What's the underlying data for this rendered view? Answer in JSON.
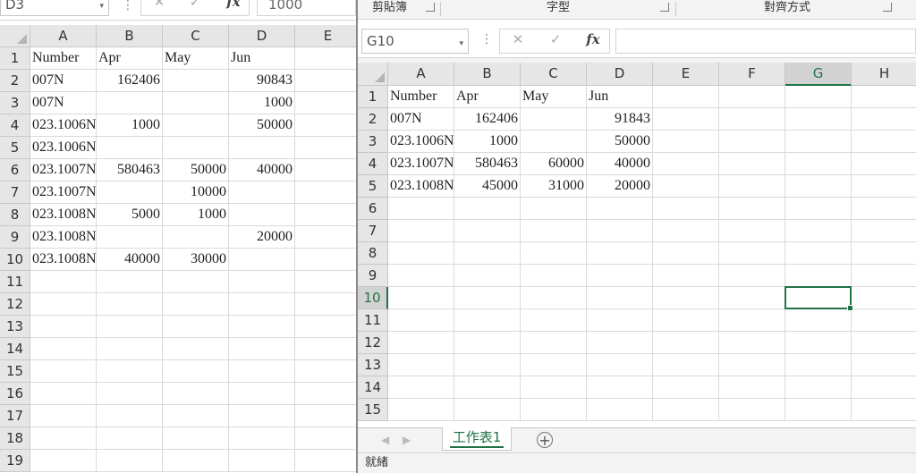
{
  "left_window": {
    "name_box": "D3",
    "formula_value": "1000",
    "columns": [
      "A",
      "B",
      "C",
      "D",
      "E"
    ],
    "rows": [
      [
        "Number",
        "Apr",
        "May",
        "Jun",
        ""
      ],
      [
        "007N",
        "162406",
        "",
        "90843",
        ""
      ],
      [
        "007N",
        "",
        "",
        "1000",
        ""
      ],
      [
        "023.1006N",
        "1000",
        "",
        "50000",
        ""
      ],
      [
        "023.1006N",
        "",
        "",
        "",
        ""
      ],
      [
        "023.1007N",
        "580463",
        "50000",
        "40000",
        ""
      ],
      [
        "023.1007N",
        "",
        "10000",
        "",
        ""
      ],
      [
        "023.1008N",
        "5000",
        "1000",
        "",
        ""
      ],
      [
        "023.1008N",
        "",
        "",
        "20000",
        ""
      ],
      [
        "023.1008N",
        "40000",
        "30000",
        "",
        ""
      ],
      [
        "",
        "",
        "",
        "",
        ""
      ],
      [
        "",
        "",
        "",
        "",
        ""
      ],
      [
        "",
        "",
        "",
        "",
        ""
      ],
      [
        "",
        "",
        "",
        "",
        ""
      ],
      [
        "",
        "",
        "",
        "",
        ""
      ],
      [
        "",
        "",
        "",
        "",
        ""
      ],
      [
        "",
        "",
        "",
        "",
        ""
      ],
      [
        "",
        "",
        "",
        "",
        ""
      ],
      [
        "",
        "",
        "",
        "",
        ""
      ]
    ],
    "row_numbers": [
      "1",
      "2",
      "3",
      "4",
      "5",
      "6",
      "7",
      "8",
      "9",
      "10",
      "11",
      "12",
      "13",
      "14",
      "15",
      "16",
      "17",
      "18",
      "19"
    ]
  },
  "right_window": {
    "ribbon_groups": [
      "剪貼簿",
      "字型",
      "對齊方式"
    ],
    "name_box": "G10",
    "formula_value": "",
    "columns": [
      "A",
      "B",
      "C",
      "D",
      "E",
      "F",
      "G",
      "H"
    ],
    "selected_column": "G",
    "selected_row": "10",
    "rows": [
      [
        "Number",
        "Apr",
        "May",
        "Jun",
        "",
        "",
        "",
        ""
      ],
      [
        "007N",
        "162406",
        "",
        "91843",
        "",
        "",
        "",
        ""
      ],
      [
        "023.1006N",
        "1000",
        "",
        "50000",
        "",
        "",
        "",
        ""
      ],
      [
        "023.1007N",
        "580463",
        "60000",
        "40000",
        "",
        "",
        "",
        ""
      ],
      [
        "023.1008N",
        "45000",
        "31000",
        "20000",
        "",
        "",
        "",
        ""
      ],
      [
        "",
        "",
        "",
        "",
        "",
        "",
        "",
        ""
      ],
      [
        "",
        "",
        "",
        "",
        "",
        "",
        "",
        ""
      ],
      [
        "",
        "",
        "",
        "",
        "",
        "",
        "",
        ""
      ],
      [
        "",
        "",
        "",
        "",
        "",
        "",
        "",
        ""
      ],
      [
        "",
        "",
        "",
        "",
        "",
        "",
        "",
        ""
      ],
      [
        "",
        "",
        "",
        "",
        "",
        "",
        "",
        ""
      ],
      [
        "",
        "",
        "",
        "",
        "",
        "",
        "",
        ""
      ],
      [
        "",
        "",
        "",
        "",
        "",
        "",
        "",
        ""
      ],
      [
        "",
        "",
        "",
        "",
        "",
        "",
        "",
        ""
      ],
      [
        "",
        "",
        "",
        "",
        "",
        "",
        "",
        ""
      ]
    ],
    "row_numbers": [
      "1",
      "2",
      "3",
      "4",
      "5",
      "6",
      "7",
      "8",
      "9",
      "10",
      "11",
      "12",
      "13",
      "14",
      "15"
    ],
    "sheet_tab": "工作表1",
    "add_sheet": "+",
    "status": "就緒"
  }
}
